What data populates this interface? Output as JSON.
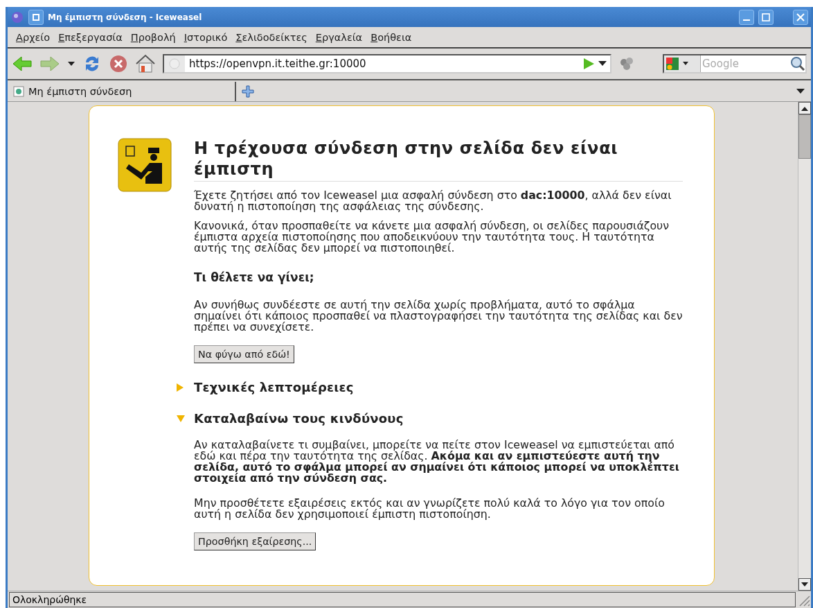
{
  "window": {
    "title": "Μη έμπιστη σύνδεση - Iceweasel"
  },
  "menu": [
    "Αρχείο",
    "Επεξεργασία",
    "Προβολή",
    "Ιστορικό",
    "Σελιδοδείκτες",
    "Εργαλεία",
    "Βοήθεια"
  ],
  "toolbar": {
    "url": "https://openvpn.it.teithe.gr:10000",
    "search": {
      "placeholder": "Google"
    }
  },
  "tabs": [
    {
      "label": "Μη έμπιστη σύνδεση",
      "selected": true
    }
  ],
  "page": {
    "title": "Η τρέχουσα σύνδεση στην σελίδα δεν είναι έμπιστη",
    "paragraphs": [
      "Έχετε ζητήσει από τον Iceweasel μια ασφαλή σύνδεση στο **dac:10000**, αλλά δεν είναι δυνατή η πιστοποίηση της ασφάλειας της σύνδεσης.",
      "Κανονικά, όταν προσπαθείτε να κάνετε μια ασφαλή σύνδεση, οι σελίδες παρουσιάζουν έμπιστα αρχεία πιστοποίησης που αποδεικνύουν την ταυτότητα τους. Η ταυτότητα αυτής της σελίδας δεν μπορεί να πιστοποιηθεί."
    ],
    "question": "Τι θέλετε να γίνει;",
    "advice": "Αν συνήθως συνδέεστε σε αυτή την σελίδα χωρίς προβλήματα, αυτό το σφάλμα σημαίνει ότι κάποιος προσπαθεί να πλαστογραφήσει την ταυτότητα της σελίδας και δεν πρέπει να συνεχίσετε.",
    "leave_button": "Να φύγω από εδώ!",
    "sections": [
      {
        "title": "Τεχνικές λεπτομέρειες",
        "expanded": false
      },
      {
        "title": "Καταλαβαίνω τους κινδύνους",
        "expanded": true,
        "paragraphs": [
          "Αν καταλαβαίνετε τι συμβαίνει, μπορείτε να πείτε στον Iceweasel να εμπιστεύεται από εδώ και πέρα την ταυτότητα της σελίδας. **Ακόμα και αν εμπιστεύεστε αυτή την σελίδα, αυτό το σφάλμα μπορεί αν σημαίνει ότι κάποιος μπορεί να υποκλέπτει στοιχεία από την σύνδεση σας.**",
          "Μην προσθέτετε εξαιρέσεις εκτός και αν γνωρίζετε πολύ καλά το λόγο για τον οποίο αυτή η σελίδα δεν χρησιμοποιεί έμπιστη πιστοποίηση."
        ],
        "button": "Προσθήκη εξαίρεσης..."
      }
    ]
  },
  "status_bar": "Ολοκληρώθηκε"
}
